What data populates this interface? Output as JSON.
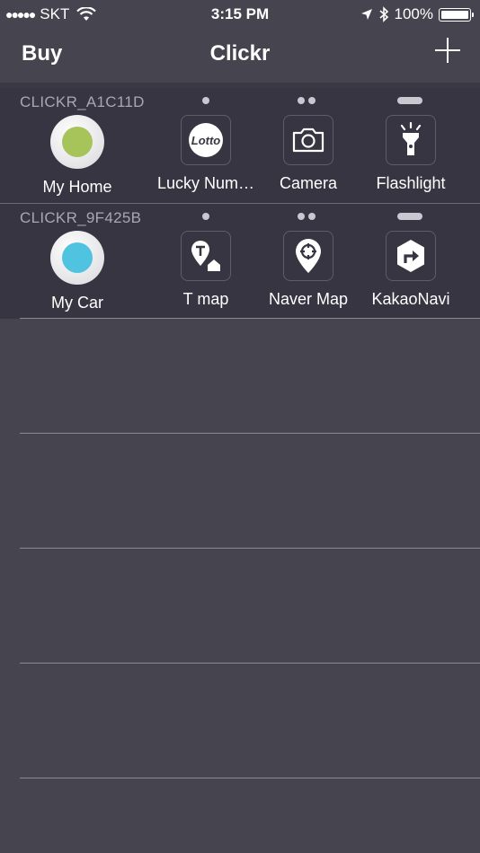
{
  "status": {
    "carrier": "SKT",
    "time": "3:15 PM",
    "battery": "100%"
  },
  "nav": {
    "left": "Buy",
    "title": "Clickr"
  },
  "devices": [
    {
      "id": "CLICKR_A1C11D",
      "main": {
        "label": "My Home",
        "color": "#a7c45a"
      },
      "actions": [
        {
          "label": "Lucky Num…",
          "icon": "lotto-icon",
          "lotto_text": "Lotto"
        },
        {
          "label": "Camera",
          "icon": "camera-icon"
        },
        {
          "label": "Flashlight",
          "icon": "flashlight-icon"
        }
      ]
    },
    {
      "id": "CLICKR_9F425B",
      "main": {
        "label": "My Car",
        "color": "#4fc3df"
      },
      "actions": [
        {
          "label": "T map",
          "icon": "tmap-icon"
        },
        {
          "label": "Naver Map",
          "icon": "naver-map-icon"
        },
        {
          "label": "KakaoNavi",
          "icon": "kakaonavi-icon"
        }
      ]
    }
  ],
  "colors": {
    "background": "#45444f",
    "device_row": "#363541",
    "home_button": "#a7c45a",
    "car_button": "#4fc3df"
  }
}
